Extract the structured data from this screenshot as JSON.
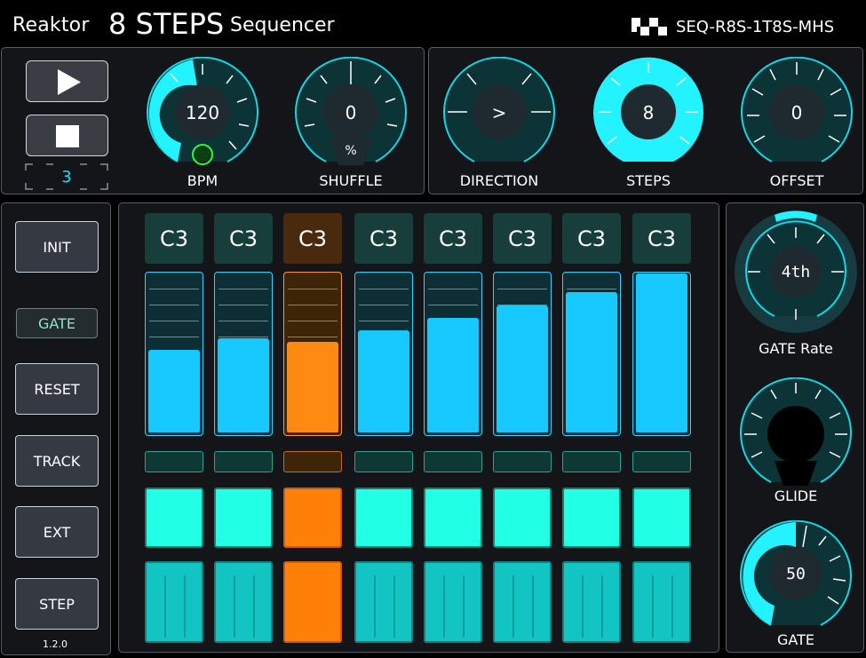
{
  "header": {
    "brand": "Reaktor",
    "title": "8 STEPS",
    "subtitle": "Sequencer",
    "code": "SEQ-R8S-1T8S-MHS"
  },
  "transport": {
    "counter": "3"
  },
  "knobs": {
    "bpm": {
      "label": "BPM",
      "value": "120"
    },
    "shuffle": {
      "label": "SHUFFLE",
      "value": "0",
      "unit": "%"
    },
    "direction": {
      "label": "DIRECTION",
      "value": ">"
    },
    "steps": {
      "label": "STEPS",
      "value": "8"
    },
    "offset": {
      "label": "OFFSET",
      "value": "0"
    },
    "gate_rate": {
      "label": "GATE Rate",
      "value": "4th"
    },
    "glide": {
      "label": "GLIDE"
    },
    "gate": {
      "label": "GATE",
      "value": "50"
    }
  },
  "side_buttons": {
    "init": "INIT",
    "gate": "GATE",
    "reset": "RESET",
    "track": "TRACK",
    "ext": "EXT",
    "step": "STEP"
  },
  "version": "1.2.0",
  "steps": {
    "active_index": 2,
    "notes": [
      "C3",
      "C3",
      "C3",
      "C3",
      "C3",
      "C3",
      "C3",
      "C3"
    ],
    "levels": [
      0.52,
      0.59,
      0.57,
      0.64,
      0.72,
      0.8,
      0.88,
      1.0
    ]
  },
  "colors": {
    "accent": "#00e5ff",
    "active": "#ff8008",
    "gate_on": "#21ffe4",
    "fader_fill": "#17c9ff"
  }
}
